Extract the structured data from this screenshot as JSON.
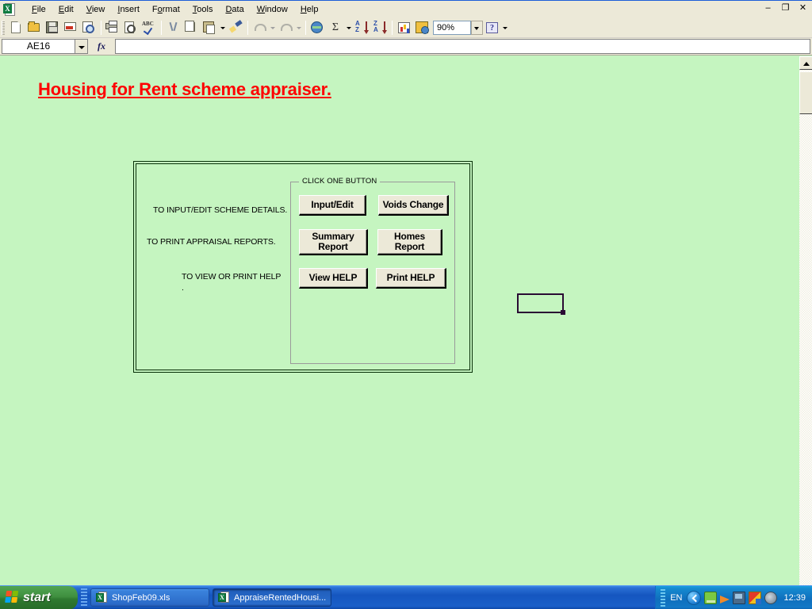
{
  "window": {
    "app_icon": "excel-icon",
    "minimize": "–",
    "restore": "❐",
    "close": "✕"
  },
  "menubar": {
    "items": [
      {
        "label": "File",
        "accel": "F"
      },
      {
        "label": "Edit",
        "accel": "E"
      },
      {
        "label": "View",
        "accel": "V"
      },
      {
        "label": "Insert",
        "accel": "I"
      },
      {
        "label": "Format",
        "accel": "o"
      },
      {
        "label": "Tools",
        "accel": "T"
      },
      {
        "label": "Data",
        "accel": "D"
      },
      {
        "label": "Window",
        "accel": "W"
      },
      {
        "label": "Help",
        "accel": "H"
      }
    ]
  },
  "toolbar": {
    "buttons": [
      {
        "name": "new-icon",
        "title": "New"
      },
      {
        "name": "open-folder-icon",
        "title": "Open"
      },
      {
        "name": "save-disk-icon",
        "title": "Save"
      },
      {
        "name": "email-icon",
        "title": "E-mail"
      },
      {
        "name": "search-icon",
        "title": "Search"
      },
      {
        "name": "print-icon",
        "title": "Print"
      },
      {
        "name": "print-preview-icon",
        "title": "Print Preview"
      },
      {
        "name": "spelling-icon",
        "title": "Spelling"
      },
      {
        "name": "cut-scissors-icon",
        "title": "Cut"
      },
      {
        "name": "copy-icon",
        "title": "Copy"
      },
      {
        "name": "paste-clipboard-icon",
        "title": "Paste"
      },
      {
        "name": "format-painter-icon",
        "title": "Format Painter"
      },
      {
        "name": "undo-arrow-icon",
        "title": "Undo"
      },
      {
        "name": "redo-arrow-icon",
        "title": "Redo"
      },
      {
        "name": "hyperlink-globe-icon",
        "title": "Insert Hyperlink"
      },
      {
        "name": "autosum-sigma-icon",
        "title": "AutoSum"
      },
      {
        "name": "sort-ascending-icon",
        "title": "Sort Ascending"
      },
      {
        "name": "sort-descending-icon",
        "title": "Sort Descending"
      },
      {
        "name": "chart-wizard-icon",
        "title": "Chart Wizard"
      },
      {
        "name": "drawing-icon",
        "title": "Drawing"
      },
      {
        "name": "help-question-icon",
        "title": "Microsoft Excel Help"
      }
    ],
    "sigma_glyph": "Σ",
    "sort_asc_top": "A",
    "sort_asc_bottom": "Z",
    "sort_desc_top": "Z",
    "sort_desc_bottom": "A",
    "help_glyph": "?",
    "zoom_value": "90%"
  },
  "formula_bar": {
    "name_box_value": "AE16",
    "fx_label": "fx",
    "formula_value": ""
  },
  "sheet": {
    "background_color": "#c5f5c0",
    "title": "Housing for Rent scheme appraiser.",
    "title_color": "#ff0000",
    "selected_cell": "AE16"
  },
  "panel": {
    "labels": [
      "TO INPUT/EDIT SCHEME DETAILS.",
      "TO PRINT APPRAISAL REPORTS.",
      "TO VIEW OR PRINT HELP",
      "."
    ],
    "group_title": "CLICK ONE BUTTON",
    "buttons": [
      {
        "label": "Input/Edit",
        "name": "input-edit-button"
      },
      {
        "label": "Voids Change",
        "name": "voids-change-button"
      },
      {
        "label": "Summary\nReport",
        "name": "summary-report-button"
      },
      {
        "label": "Homes\nReport",
        "name": "homes-report-button"
      },
      {
        "label": "View HELP",
        "name": "view-help-button"
      },
      {
        "label": "Print HELP",
        "name": "print-help-button"
      }
    ]
  },
  "taskbar": {
    "start_label": "start",
    "tasks": [
      {
        "label": "ShopFeb09.xls",
        "active": false
      },
      {
        "label": "AppraiseRentedHousi...",
        "active": true
      }
    ],
    "tray": {
      "language": "EN",
      "icons": [
        "network-icon",
        "volume-cone-icon",
        "monitor-icon",
        "security-shield-icon",
        "speaker-icon"
      ],
      "clock": "12:39"
    }
  }
}
